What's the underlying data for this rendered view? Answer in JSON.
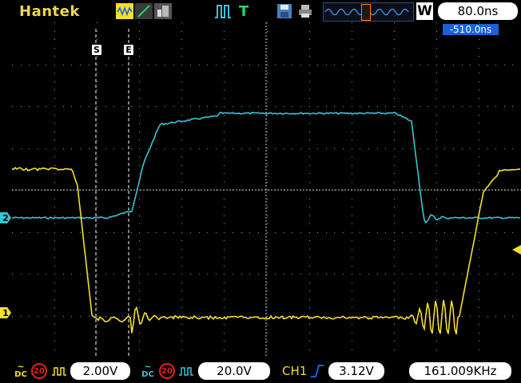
{
  "header": {
    "brand": "Hantek",
    "wbox": "W",
    "timebase": "80.0ns",
    "trigger_mode_glyph": "T"
  },
  "screen": {
    "horizontal_offset": "-510.0ns",
    "cursor_start_label": "S",
    "cursor_end_label": "E",
    "ch1_marker": "1",
    "ch2_marker": "2"
  },
  "footer": {
    "ch1_coupling": "DC",
    "ch1_bw_limit": "20",
    "ch1_vdiv": "2.00V",
    "ch2_coupling": "DC",
    "ch2_bw_limit": "20",
    "ch2_vdiv": "20.0V",
    "trigger_source": "CH1",
    "trigger_level": "3.12V",
    "frequency": "161.009KHz"
  },
  "colors": {
    "ch1": "#f7df2b",
    "ch2": "#36c6d6",
    "brand": "#f2d64b",
    "offset_badge": "#1a63d6",
    "grid": "#d0d0d0"
  },
  "icons": [
    "waveform-icon",
    "slope-icon",
    "persistence-icon",
    "run-stop-icon",
    "trigger-icon",
    "save-icon",
    "print-icon"
  ]
}
